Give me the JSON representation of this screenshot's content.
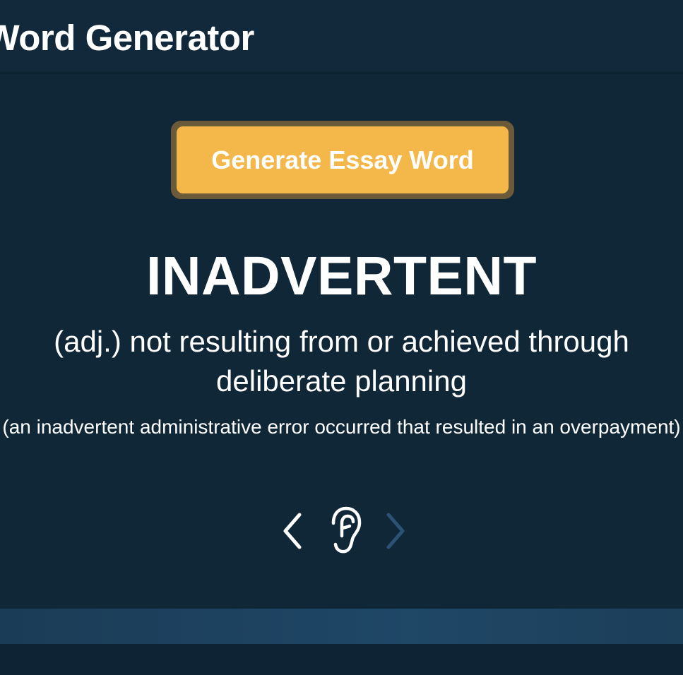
{
  "header": {
    "title": "y Word Generator"
  },
  "generate_button": {
    "label": "Generate Essay Word"
  },
  "word": {
    "text": "INADVERTENT",
    "definition": "(adj.) not resulting from or achieved through deliberate planning",
    "example": "(an inadvertent administrative error occurred that resulted in an overpayment)"
  },
  "nav": {
    "prev_icon": "chevron-left-icon",
    "listen_icon": "ear-icon",
    "next_icon": "chevron-right-icon",
    "next_enabled": false
  },
  "colors": {
    "background": "#102738",
    "button": "#f3b74a",
    "button_border": "#6b5a3a",
    "disabled_icon": "#2b5273"
  }
}
